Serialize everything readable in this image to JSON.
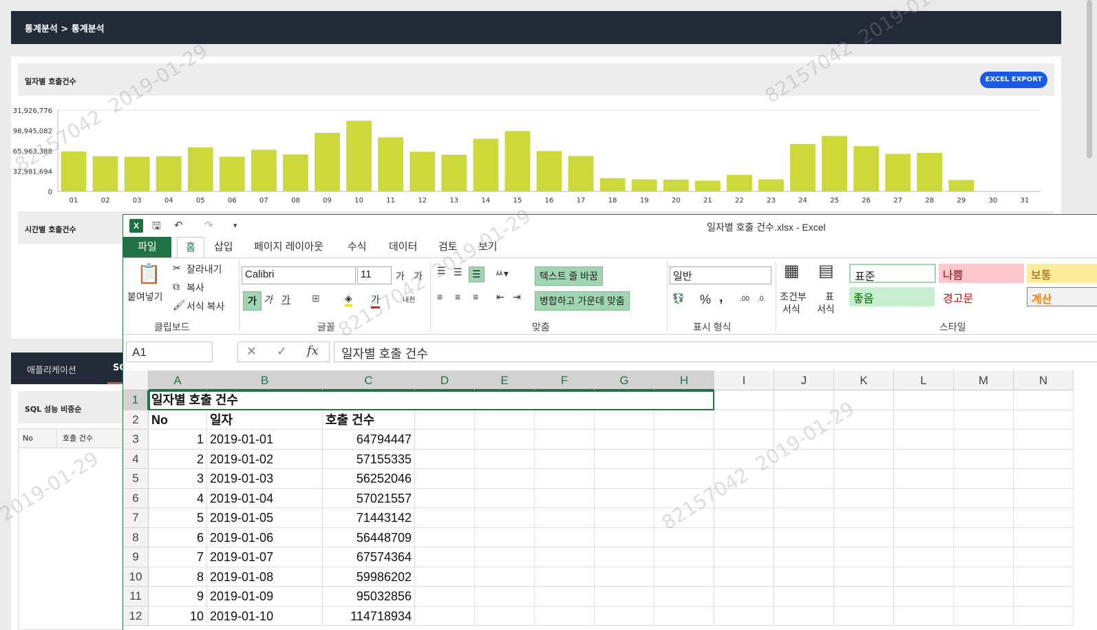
{
  "breadcrumb": "통계분석 > 통계분석",
  "daily_panel": {
    "title": "일자별 호출건수",
    "export_label": "EXCEL EXPORT"
  },
  "hourly_panel": {
    "title": "시간별 호출건수"
  },
  "bottom_tabs": {
    "tab1": "애플리케이션",
    "tab2": "SC"
  },
  "sql_panel": {
    "title": "SQL 성능 비중순",
    "col_no": "No",
    "col_calls": "호출 건수"
  },
  "chart_data": {
    "type": "bar",
    "categories": [
      "01",
      "02",
      "03",
      "04",
      "05",
      "06",
      "07",
      "08",
      "09",
      "10",
      "11",
      "12",
      "13",
      "14",
      "15",
      "16",
      "17",
      "18",
      "19",
      "20",
      "21",
      "22",
      "23",
      "24",
      "25",
      "26",
      "27",
      "28",
      "29",
      "30",
      "31"
    ],
    "values": [
      64794447,
      57155335,
      56252046,
      57021557,
      71443142,
      56448709,
      67574364,
      59986202,
      95032856,
      114718934,
      88000000,
      64500000,
      59500000,
      85500000,
      98000000,
      65500000,
      57500000,
      21500000,
      19500000,
      19000000,
      17500000,
      27000000,
      19500000,
      77000000,
      90000000,
      73500000,
      61000000,
      62500000,
      18500000,
      0,
      0
    ],
    "y_tick_labels": [
      "0",
      "32,981,694",
      "65,963,388",
      "98,945,082",
      "31,926,776"
    ],
    "ylim": [
      0,
      131926776
    ],
    "bar_color": "#cdd93a"
  },
  "excel": {
    "window_title": "일자별 호출 건수.xlsx - Excel",
    "tabs": [
      "파일",
      "홈",
      "삽입",
      "페이지 레이아웃",
      "수식",
      "데이터",
      "검토",
      "보기"
    ],
    "clipboard": {
      "paste": "붙여넣기",
      "cut": "잘라내기",
      "copy": "복사",
      "format_copy": "서식 복사",
      "label": "클립보드"
    },
    "font": {
      "name": "Calibri",
      "size": "11",
      "label": "글꼴",
      "bold": "가",
      "italic": "가",
      "underline": "가",
      "grow": "가",
      "shrink": "가",
      "font_color": "가",
      "phonetic": "내천"
    },
    "align": {
      "wrap": "텍스트 줄 바꿈",
      "merge": "병합하고 가운데 맞춤",
      "label": "맞춤"
    },
    "number": {
      "format": "일반",
      "label": "표시 형식",
      "percent": "%",
      "comma": ",",
      "inc": ".00",
      "dec": ".0"
    },
    "styles": {
      "cond": "조건부",
      "cond2": "서식",
      "table": "표",
      "table2": "서식",
      "normal": "표준",
      "bad": "나쁨",
      "neutral": "보통",
      "good": "좋음",
      "warning": "경고문",
      "calc": "계산",
      "label": "스타일"
    },
    "name_box": "A1",
    "formula": "일자별 호출 건수",
    "columns": [
      "A",
      "B",
      "C",
      "D",
      "E",
      "F",
      "G",
      "H",
      "I",
      "J",
      "K",
      "L",
      "M",
      "N"
    ],
    "rows": [
      [
        "일자별 호출 건수",
        "",
        ""
      ],
      [
        "No",
        "일자",
        "호출 건수"
      ],
      [
        "1",
        "2019-01-01",
        "64794447"
      ],
      [
        "2",
        "2019-01-02",
        "57155335"
      ],
      [
        "3",
        "2019-01-03",
        "56252046"
      ],
      [
        "4",
        "2019-01-04",
        "57021557"
      ],
      [
        "5",
        "2019-01-05",
        "71443142"
      ],
      [
        "6",
        "2019-01-06",
        "56448709"
      ],
      [
        "7",
        "2019-01-07",
        "67574364"
      ],
      [
        "8",
        "2019-01-08",
        "59986202"
      ],
      [
        "9",
        "2019-01-09",
        "95032856"
      ],
      [
        "10",
        "2019-01-10",
        "114718934"
      ]
    ]
  },
  "watermark": {
    "id": "82157042",
    "date": "2019-01-29"
  }
}
